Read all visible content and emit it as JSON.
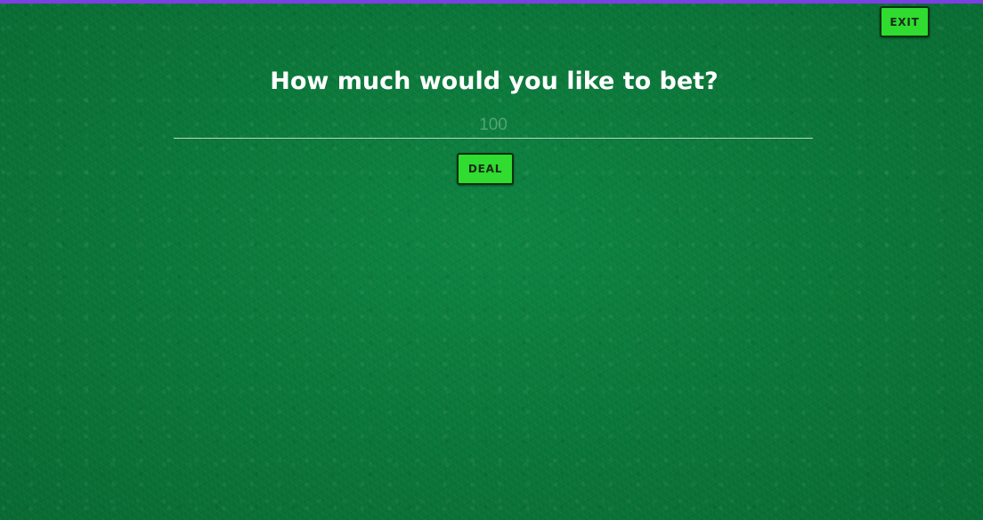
{
  "header": {
    "exit_label": "EXIT"
  },
  "bet": {
    "prompt": "How much would you like to bet?",
    "input_value": "",
    "input_placeholder": "100",
    "deal_label": "DEAL"
  },
  "colors": {
    "table_felt": "#0b7a3a",
    "top_bar": "#7b3fe4",
    "button_bg": "#2fdc2f",
    "button_border": "#0b2f12",
    "title_text": "#ffffff"
  }
}
